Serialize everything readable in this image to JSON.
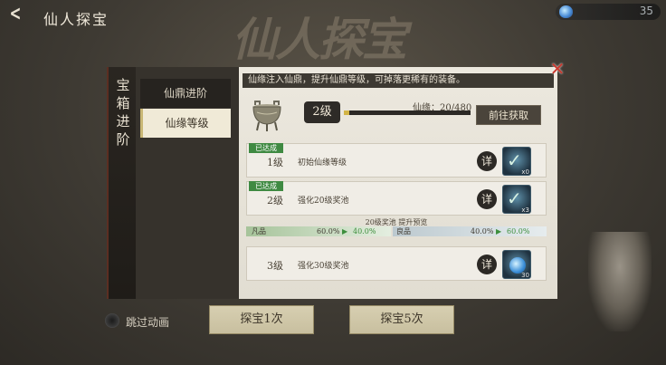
{
  "header": {
    "back_icon": "back-arrow-icon",
    "title": "仙人探宝",
    "currency_icon": "blue-gem-icon",
    "currency_value": "35",
    "calligraphy": "仙人探宝"
  },
  "side_tab": {
    "label": "宝箱进阶"
  },
  "menu": {
    "items": [
      {
        "label": "仙鼎进阶"
      },
      {
        "label": "仙缘等级"
      }
    ]
  },
  "content": {
    "description": "仙缘注入仙鼎，提升仙鼎等级，可掉落更稀有的装备。",
    "level_badge": "2级",
    "xianyuan_label": "仙缘：20/480",
    "progress_fraction": 0.0417,
    "goto_button": "前往获取",
    "rows": [
      {
        "badge": "已达成",
        "level": "1级",
        "text": "初始仙缘等级",
        "detail": "详",
        "reward_count": "x0"
      },
      {
        "badge": "已达成",
        "level": "2级",
        "text": "强化20级奖池",
        "detail": "详",
        "reward_count": "x3"
      },
      {
        "badge": "",
        "level": "3级",
        "text": "强化30级奖池",
        "detail": "详",
        "reward_count": "30"
      }
    ],
    "preview": {
      "title": "20级奖池 提升预览",
      "left_label": "凡品",
      "left_from": "60.0%",
      "left_to": "40.0%",
      "right_label": "良品",
      "right_from": "40.0%",
      "right_to": "60.0%"
    }
  },
  "footer": {
    "skip_label": "跳过动画",
    "button_1": "探宝1次",
    "button_5": "探宝5次"
  },
  "colors": {
    "achieved_green": "#3f8a42",
    "progress_gold": "#d2b445",
    "close_red": "#c8392f"
  }
}
